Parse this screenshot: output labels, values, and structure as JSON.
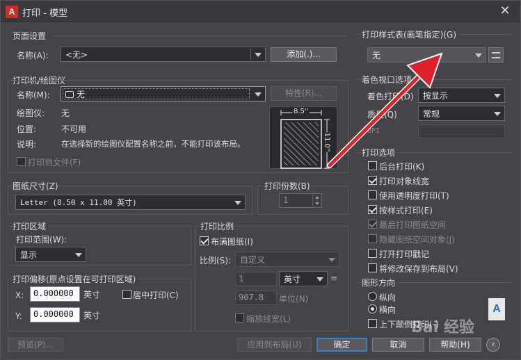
{
  "window": {
    "title": "打印 - 模型",
    "app_icon_letter": "A"
  },
  "page_setup": {
    "group_label": "页面设置",
    "name_label": "名称(A):",
    "name_value": "<无>",
    "add_button": "添加(.)..."
  },
  "printer": {
    "group_label": "打印机/绘图仪",
    "name_label": "名称(M):",
    "name_value": "无",
    "properties_button": "特性(R)...",
    "plotter_label": "绘图仪:",
    "plotter_value": "无",
    "location_label": "位置:",
    "location_value": "不可用",
    "description_label": "说明:",
    "description_value": "在选择新的绘图仪配置名称之前，不能打印该布局。",
    "print_to_file": "打印到文件(F)",
    "preview_width": "8.5''",
    "preview_height": "11.0''"
  },
  "paper_size": {
    "group_label": "图纸尺寸(Z)",
    "value": "Letter (8.50 x 11.00 英寸)"
  },
  "copies": {
    "label": "打印份数(B)",
    "value": "1"
  },
  "plot_area": {
    "group_label": "打印区域",
    "range_label": "打印范围(W):",
    "range_value": "显示"
  },
  "plot_offset": {
    "group_label": "打印偏移(原点设置在可打印区域)",
    "x_label": "X:",
    "x_value": "0.000000",
    "x_unit": "英寸",
    "y_label": "Y:",
    "y_value": "0.000000",
    "y_unit": "英寸",
    "center_label": "居中打印(C)"
  },
  "plot_scale": {
    "group_label": "打印比例",
    "fit_label": "布满图纸(I)",
    "scale_label": "比例(S):",
    "scale_value": "自定义",
    "value1": "1",
    "unit_value": "英寸",
    "equals": "=",
    "value2": "907.8",
    "unit_label": "单位(N)",
    "lineweights_label": "缩放线宽(L)"
  },
  "style_table": {
    "group_label": "打印样式表(画笔指定)(G)",
    "value": "无"
  },
  "shaded_viewport": {
    "group_label": "着色视口选项",
    "shade_label": "着色打印(D)",
    "shade_value": "按显示",
    "quality_label": "质量(Q)",
    "quality_value": "常规",
    "dpi_label": "DPI"
  },
  "plot_options": {
    "group_label": "打印选项",
    "items": [
      {
        "label": "后台打印(K)"
      },
      {
        "label": "打印对象线宽"
      },
      {
        "label": "使用透明度打印(T)"
      },
      {
        "label": "按样式打印(E)"
      },
      {
        "label": "最后打印图纸空间"
      },
      {
        "label": "隐藏图纸空间对象(J)"
      },
      {
        "label": "打开打印戳记"
      },
      {
        "label": "将修改保存到布局(V)"
      }
    ]
  },
  "orientation": {
    "group_label": "图形方向",
    "portrait": "纵向",
    "landscape": "横向",
    "upside_down": "上下颠倒打印(-)",
    "icon_letter": "A"
  },
  "footer": {
    "preview": "预览(P)...",
    "apply": "应用到布局(U)",
    "ok": "确定",
    "cancel": "取消",
    "help": "帮助(H)"
  },
  "watermark": "Bai 经验"
}
